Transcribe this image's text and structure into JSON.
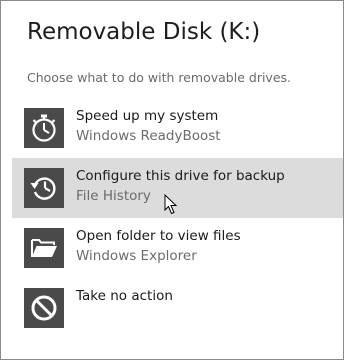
{
  "dialog": {
    "title": "Removable Disk (K:)",
    "subtitle": "Choose what to do with removable drives."
  },
  "options": [
    {
      "title": "Speed up my system",
      "subtitle": "Windows ReadyBoost",
      "icon": "stopwatch-icon"
    },
    {
      "title": "Configure this drive for backup",
      "subtitle": "File History",
      "icon": "history-clock-icon",
      "highlighted": true
    },
    {
      "title": "Open folder to view files",
      "subtitle": "Windows Explorer",
      "icon": "open-folder-icon"
    },
    {
      "title": "Take no action",
      "subtitle": "",
      "icon": "no-action-icon"
    }
  ],
  "colors": {
    "icon_tile": "#4a4a4a",
    "highlight": "#dcdcdc"
  }
}
